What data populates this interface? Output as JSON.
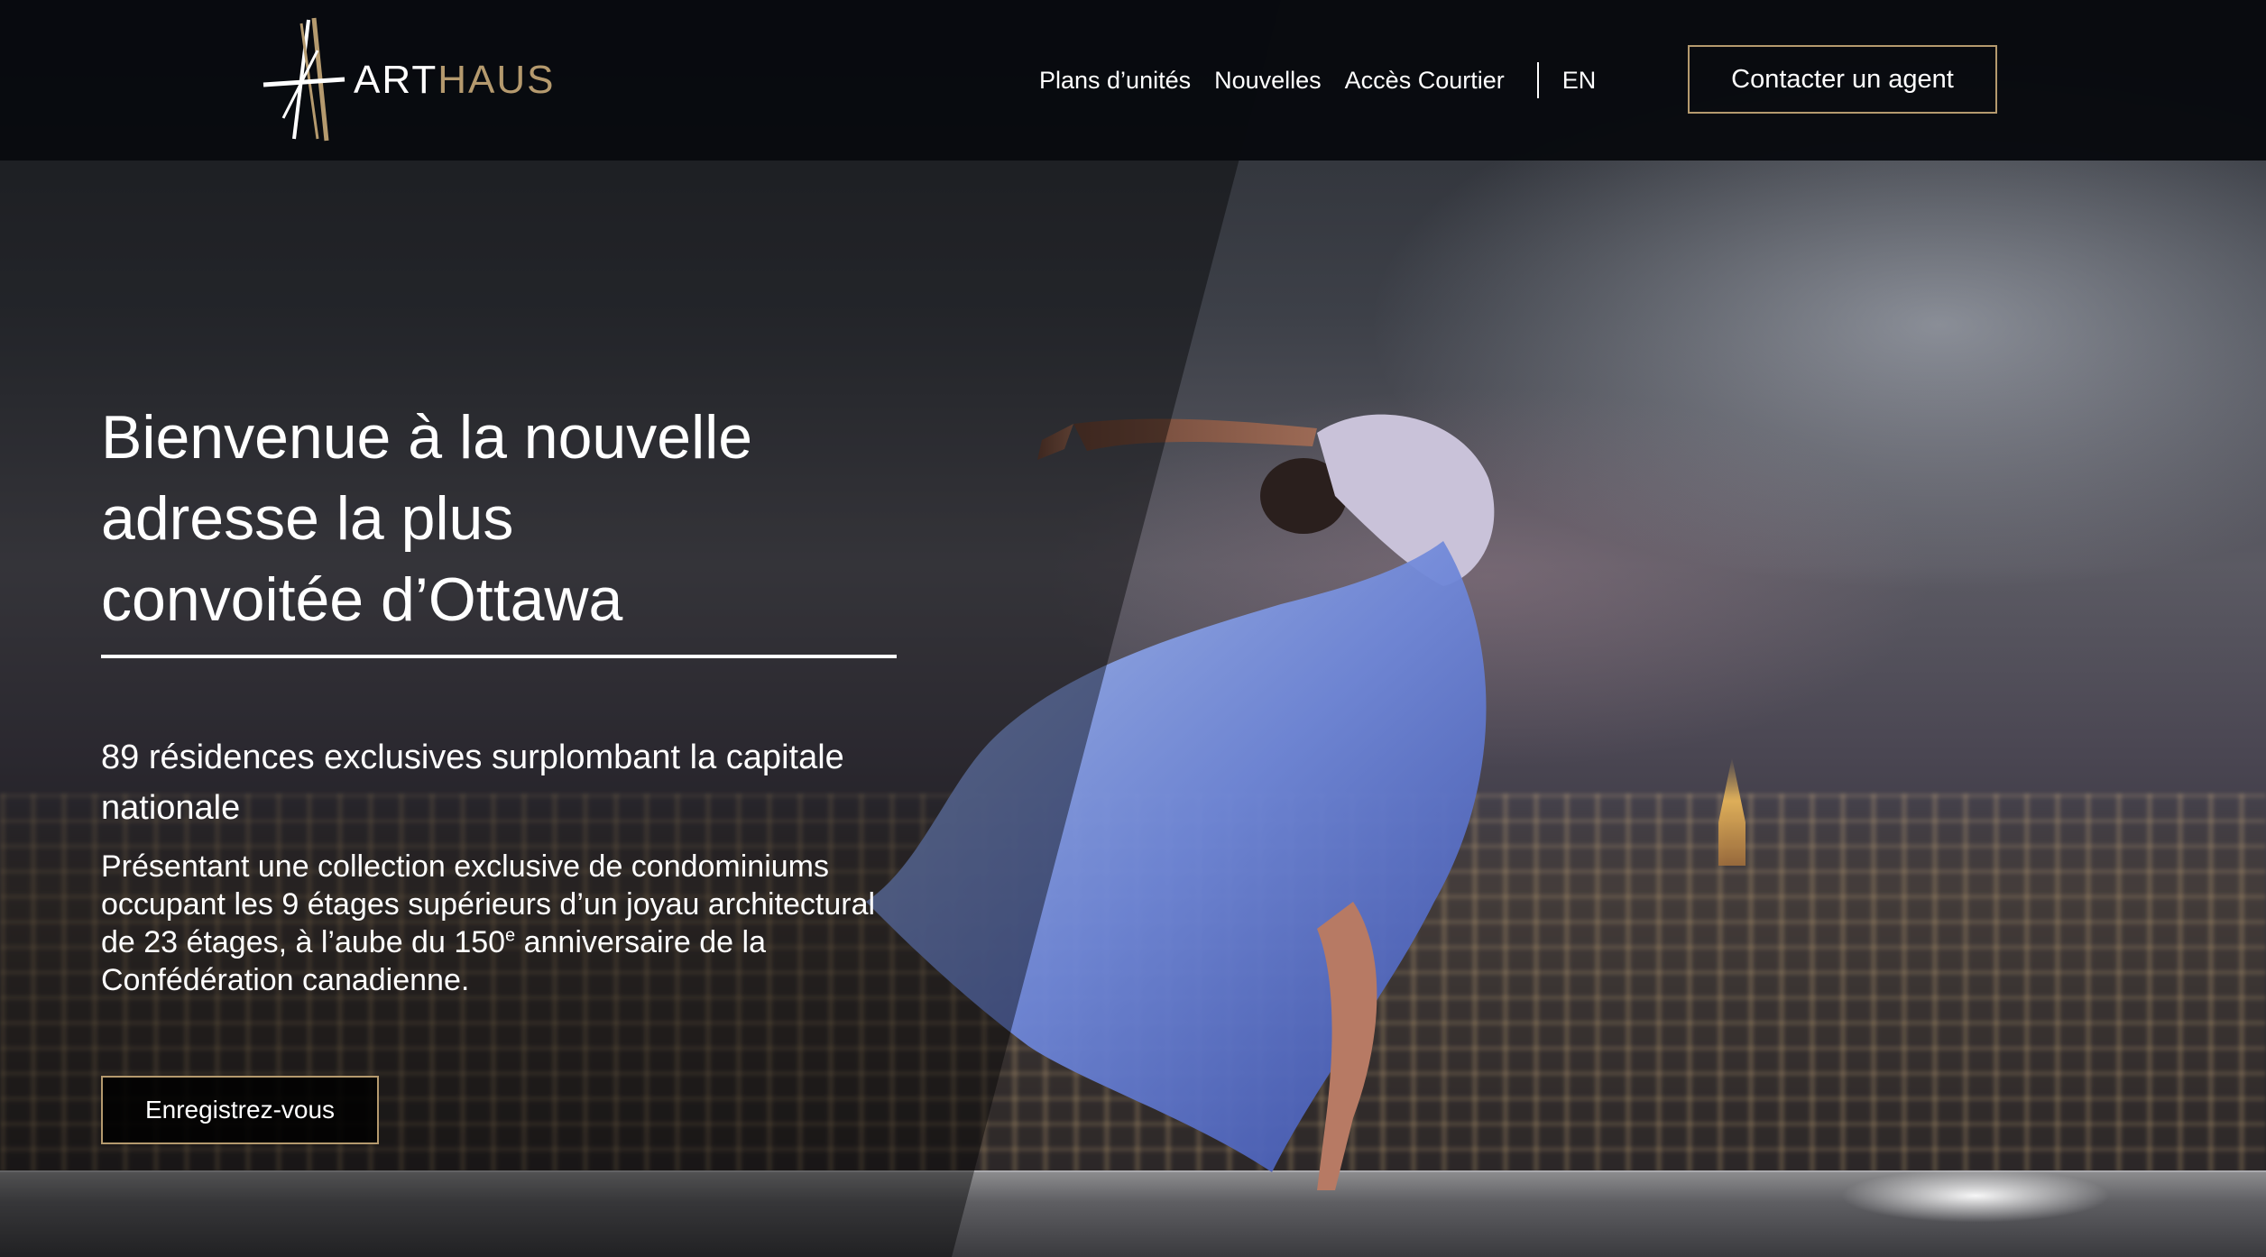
{
  "header": {
    "logo": {
      "part1": "ART",
      "part2": "HAUS"
    },
    "nav": {
      "items": [
        {
          "label": "Plans d’unités"
        },
        {
          "label": "Nouvelles"
        },
        {
          "label": "Accès Courtier"
        }
      ],
      "language": "EN"
    },
    "cta_label": "Contacter un agent"
  },
  "hero": {
    "headline_lines": [
      "Bienvenue à la nouvelle",
      "adresse la plus",
      "convoitée d’Ottawa"
    ],
    "subhead": "89 résidences exclusives surplombant la capitale nationale",
    "body_part1": "Présentant une collection exclusive de condominiums occupant les 9 étages supérieurs d’un joyau architectural de 23 étages, à l’aube du 150",
    "body_sup": "e",
    "body_part2": " anniversaire de la Confédération canadienne.",
    "register_label": "Enregistrez-vous"
  },
  "colors": {
    "header_bg": "#080a0e",
    "accent_gold": "#b59a6e",
    "text": "#ffffff"
  }
}
